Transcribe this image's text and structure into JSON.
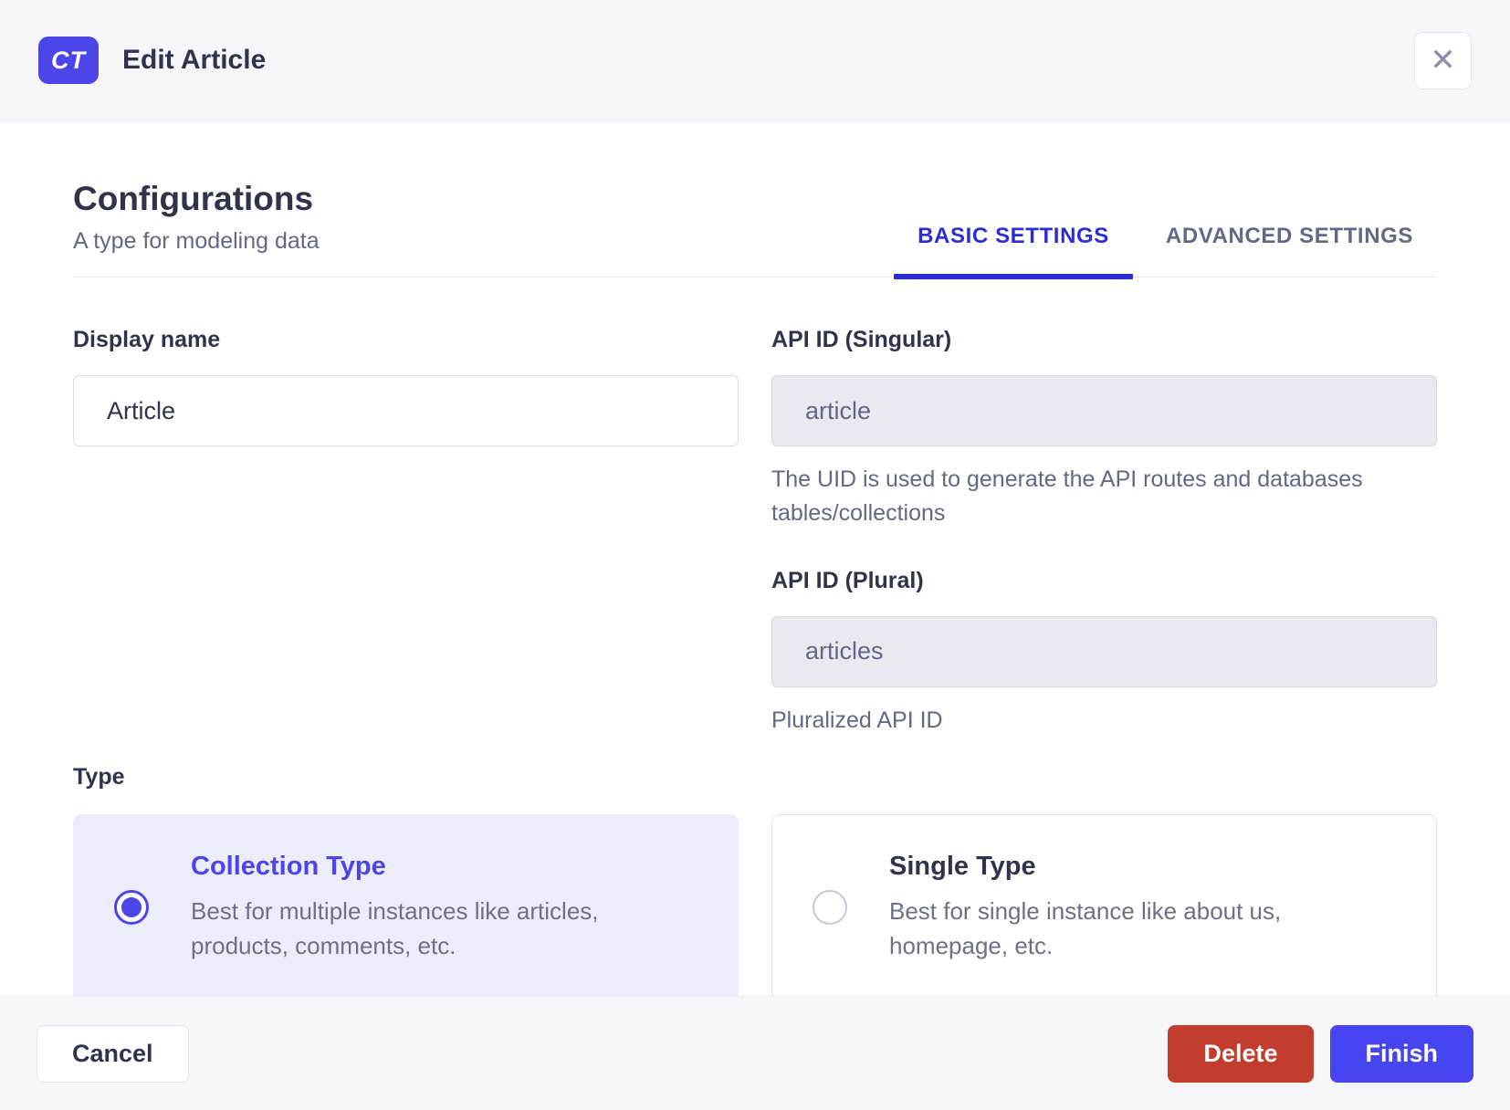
{
  "header": {
    "badge": "CT",
    "title": "Edit Article",
    "close_icon": "✕"
  },
  "section": {
    "title": "Configurations",
    "subtitle": "A type for modeling data"
  },
  "tabs": [
    {
      "label": "BASIC SETTINGS",
      "active": true
    },
    {
      "label": "ADVANCED SETTINGS",
      "active": false
    }
  ],
  "form": {
    "display_name": {
      "label": "Display name",
      "value": "Article"
    },
    "api_id_singular": {
      "label": "API ID (Singular)",
      "value": "article",
      "hint": "The UID is used to generate the API routes and databases tables/collections"
    },
    "api_id_plural": {
      "label": "API ID (Plural)",
      "value": "articles",
      "hint": "Pluralized API ID"
    },
    "type": {
      "label": "Type",
      "options": [
        {
          "title": "Collection Type",
          "description": "Best for multiple instances like articles, products, comments, etc.",
          "selected": true
        },
        {
          "title": "Single Type",
          "description": "Best for single instance like about us, homepage, etc.",
          "selected": false
        }
      ]
    }
  },
  "footer": {
    "cancel": "Cancel",
    "delete": "Delete",
    "finish": "Finish"
  },
  "colors": {
    "primary": "#4c46e8",
    "tab_active": "#2d2dd6",
    "delete_red": "#c23d2d",
    "finish_indigo": "#4745f0",
    "surface_gray": "#f6f6f9"
  }
}
